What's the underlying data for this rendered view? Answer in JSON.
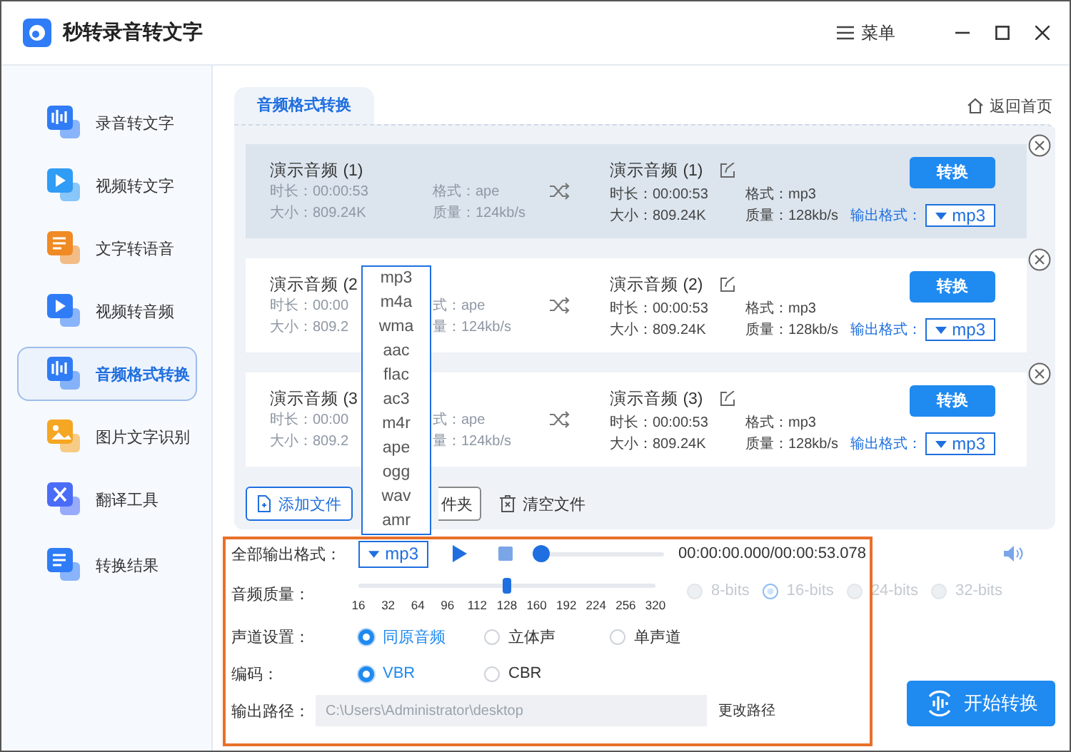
{
  "app": {
    "title": "秒转录音转文字",
    "menu_label": "菜单"
  },
  "sidebar": {
    "items": [
      {
        "label": "录音转文字",
        "selected": false
      },
      {
        "label": "视频转文字",
        "selected": false
      },
      {
        "label": "文字转语音",
        "selected": false
      },
      {
        "label": "视频转音频",
        "selected": false
      },
      {
        "label": "音频格式转换",
        "selected": true
      },
      {
        "label": "图片文字识别",
        "selected": false
      },
      {
        "label": "翻译工具",
        "selected": false
      },
      {
        "label": "转换结果",
        "selected": false
      }
    ]
  },
  "tabs": [
    {
      "label": "音频格式转换",
      "selected": true
    }
  ],
  "home_link": "返回首页",
  "files": [
    {
      "selected": true,
      "source": {
        "name": "演示音频 (1)",
        "duration": "时长：00:00:53",
        "size": "大小：809.24K",
        "format": "格式：ape",
        "quality": "质量：124kb/s"
      },
      "output": {
        "name": "演示音频 (1)",
        "duration": "时长：00:00:53",
        "size": "大小：809.24K",
        "format": "格式：mp3",
        "quality": "质量：128kb/s"
      },
      "convert_button": "转换",
      "output_format_label": "输出格式：",
      "output_format": "mp3"
    },
    {
      "selected": false,
      "source": {
        "name": "演示音频 (2",
        "duration": "时长：00:00",
        "size": "大小：809.2",
        "format": "式：ape",
        "quality": "量：124kb/s"
      },
      "output": {
        "name": "演示音频 (2)",
        "duration": "时长：00:00:53",
        "size": "大小：809.24K",
        "format": "格式：mp3",
        "quality": "质量：128kb/s"
      },
      "convert_button": "转换",
      "output_format_label": "输出格式：",
      "output_format": "mp3"
    },
    {
      "selected": false,
      "source": {
        "name": "演示音频 (3",
        "duration": "时长：00:00",
        "size": "大小：809.2",
        "format": "式：ape",
        "quality": "量：124kb/s"
      },
      "output": {
        "name": "演示音频 (3)",
        "duration": "时长：00:00:53",
        "size": "大小：809.24K",
        "format": "格式：mp3",
        "quality": "质量：128kb/s"
      },
      "convert_button": "转换",
      "output_format_label": "输出格式：",
      "output_format": "mp3"
    }
  ],
  "toolbar": [
    {
      "kind": "add-file",
      "label": "添加文件"
    },
    {
      "kind": "add-folder",
      "label": "件夹"
    },
    {
      "kind": "clear",
      "label": "清空文件"
    }
  ],
  "format_dropdown": {
    "options": [
      "mp3",
      "m4a",
      "wma",
      "aac",
      "flac",
      "ac3",
      "m4r",
      "ape",
      "ogg",
      "wav",
      "amr"
    ]
  },
  "settings": {
    "format_label": "全部输出格式：",
    "format": "mp3",
    "playback": {
      "level": 0,
      "time": "00:00:00.000/00:00:53.078"
    },
    "quality": {
      "label": "音频质量：",
      "ticks": [
        "16",
        "32",
        "64",
        "96",
        "112",
        "128",
        "160",
        "192",
        "224",
        "256",
        "320"
      ],
      "level": 0.5
    },
    "bit_depths": [
      {
        "label": "8-bits",
        "selected": false,
        "disabled": true
      },
      {
        "label": "16-bits",
        "selected": true,
        "disabled": true
      },
      {
        "label": "24-bits",
        "selected": false,
        "disabled": true
      },
      {
        "label": "32-bits",
        "selected": false,
        "disabled": true
      }
    ],
    "channel_label": "声道设置：",
    "channels": [
      {
        "label": "同原音频",
        "selected": true
      },
      {
        "label": "立体声",
        "selected": false
      },
      {
        "label": "单声道",
        "selected": false
      }
    ],
    "encoding_label": "编码：",
    "encodings": [
      {
        "label": "VBR",
        "selected": true
      },
      {
        "label": "CBR",
        "selected": false
      }
    ],
    "path_label": "输出路径：",
    "path": "C:\\Users\\Administrator\\desktop",
    "change_path": "更改路径"
  },
  "start_button": "开始转换"
}
